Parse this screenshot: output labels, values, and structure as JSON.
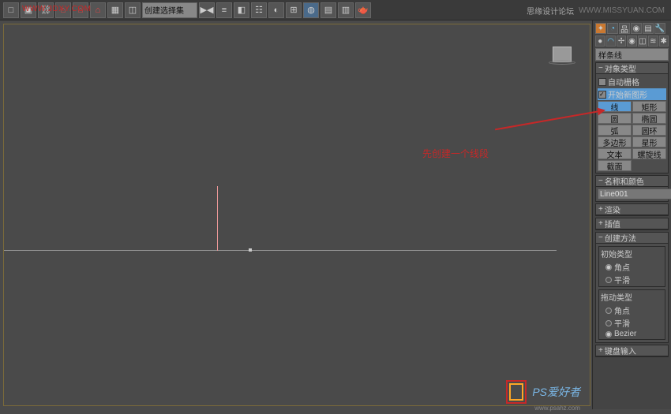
{
  "toolbar": {
    "dropdown": "创建选择集",
    "watermark": "WWW.3DXY.COM"
  },
  "header_right": {
    "brand": "思缘设计论坛",
    "url": "WWW.MISSYUAN.COM"
  },
  "annotation": "先创建一个线段",
  "panel": {
    "dropdown": "样条线",
    "rollouts": {
      "object_type": {
        "title": "对象类型",
        "auto_grid": "自动栅格",
        "start_new": "开始新图形",
        "buttons": [
          [
            "线",
            "矩形"
          ],
          [
            "圆",
            "椭圆"
          ],
          [
            "弧",
            "圆环"
          ],
          [
            "多边形",
            "星形"
          ],
          [
            "文本",
            "螺旋线"
          ],
          [
            "截面",
            ""
          ]
        ]
      },
      "name_color": {
        "title": "名称和颜色",
        "value": "Line001"
      },
      "render": "渲染",
      "interp": "插值",
      "create_method": {
        "title": "创建方法",
        "initial": {
          "label": "初始类型",
          "opts": [
            "角点",
            "平滑"
          ]
        },
        "drag": {
          "label": "拖动类型",
          "opts": [
            "角点",
            "平滑",
            "Bezier"
          ]
        }
      },
      "keyboard": "键盘输入"
    }
  },
  "footer": {
    "brand": "PS爱好者",
    "url": "www.psahz.com"
  }
}
